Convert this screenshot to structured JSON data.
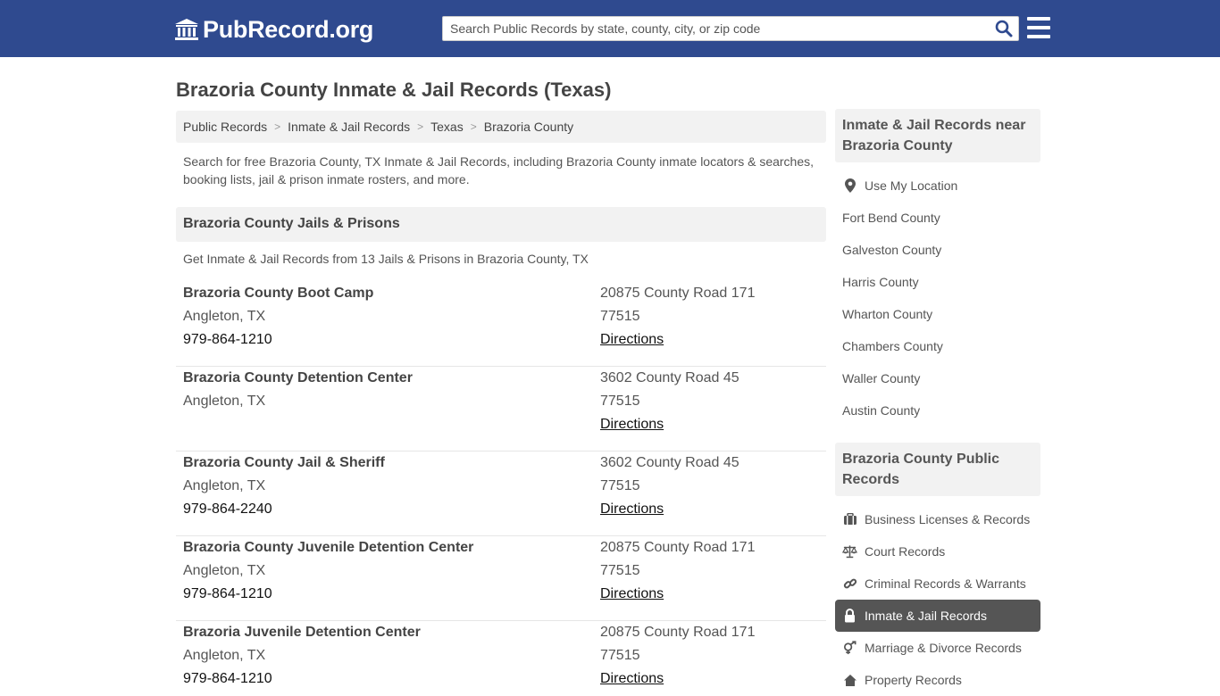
{
  "header": {
    "logo_text": "PubRecord.org",
    "search_placeholder": "Search Public Records by state, county, city, or zip code",
    "brand_color": "#2f4a8f"
  },
  "page": {
    "title": "Brazoria County Inmate & Jail Records (Texas)",
    "intro": "Search for free Brazoria County, TX Inmate & Jail Records, including Brazoria County inmate locators & searches, booking lists, jail & prison inmate rosters, and more."
  },
  "breadcrumb": [
    "Public Records",
    "Inmate & Jail Records",
    "Texas",
    "Brazoria County"
  ],
  "facilities": {
    "heading": "Brazoria County Jails & Prisons",
    "subheading": "Get Inmate & Jail Records from 13 Jails & Prisons in Brazoria County, TX",
    "directions_label": "Directions",
    "items": [
      {
        "name": "Brazoria County Boot Camp",
        "city": "Angleton, TX",
        "phone": "979-864-1210",
        "address": "20875 County Road 171",
        "zip": "77515"
      },
      {
        "name": "Brazoria County Detention Center",
        "city": "Angleton, TX",
        "phone": "",
        "address": "3602 County Road 45",
        "zip": "77515"
      },
      {
        "name": "Brazoria County Jail & Sheriff",
        "city": "Angleton, TX",
        "phone": "979-864-2240",
        "address": "3602 County Road 45",
        "zip": "77515"
      },
      {
        "name": "Brazoria County Juvenile Detention Center",
        "city": "Angleton, TX",
        "phone": "979-864-1210",
        "address": "20875 County Road 171",
        "zip": "77515"
      },
      {
        "name": "Brazoria Juvenile Detention Center",
        "city": "Angleton, TX",
        "phone": "979-864-1210",
        "address": "20875 County Road 171",
        "zip": "77515"
      }
    ]
  },
  "sidebar": {
    "nearby_heading": "Inmate & Jail Records near Brazoria County",
    "use_location": "Use My Location",
    "nearby": [
      "Fort Bend County",
      "Galveston County",
      "Harris County",
      "Wharton County",
      "Chambers County",
      "Waller County",
      "Austin County"
    ],
    "public_heading": "Brazoria County Public Records",
    "categories": [
      {
        "label": "Business Licenses & Records",
        "icon": "briefcase-icon"
      },
      {
        "label": "Court Records",
        "icon": "scales-icon"
      },
      {
        "label": "Criminal Records & Warrants",
        "icon": "link-icon"
      },
      {
        "label": "Inmate & Jail Records",
        "icon": "lock-icon",
        "active": true
      },
      {
        "label": "Marriage & Divorce Records",
        "icon": "gender-icon"
      },
      {
        "label": "Property Records",
        "icon": "home-icon"
      }
    ]
  }
}
